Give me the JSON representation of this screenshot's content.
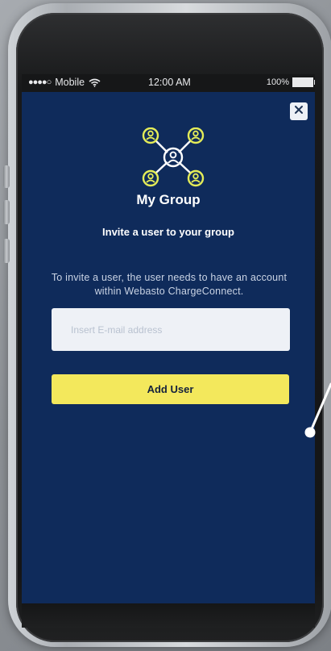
{
  "status_bar": {
    "carrier": "Mobile",
    "signal_dots": "●●●●○",
    "time": "12:00 AM",
    "battery": "100%"
  },
  "icons": {
    "close": "close-icon",
    "wifi": "wifi-icon",
    "battery": "battery-icon",
    "group": "group-network-icon"
  },
  "header": {
    "title": "My Group"
  },
  "invite": {
    "subtitle": "Invite a user to your group",
    "description": "To invite a user, the user needs to have an account within Webasto ChargeConnect.",
    "email_placeholder": "Insert E-mail address",
    "email_value": "",
    "add_user_label": "Add User"
  },
  "colors": {
    "background": "#0f2b5b",
    "accent": "#f3e85c",
    "input_bg": "#eef1f6",
    "text": "#ffffff"
  }
}
